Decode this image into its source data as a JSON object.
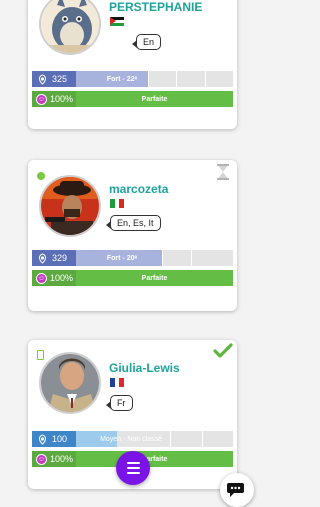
{
  "cards": [
    {
      "username": "PERSTEPHANIE",
      "languages": "En",
      "level_value": "325",
      "level_label": "Fort - 22ᵉ",
      "level_progress": 0.46,
      "reputation_value": "100%",
      "reputation_label": "Parfaite"
    },
    {
      "username": "marcozeta",
      "languages": "En, Es, It",
      "level_value": "329",
      "level_label": "Fort - 20ᵉ",
      "level_progress": 0.55,
      "reputation_value": "100%",
      "reputation_label": "Parfaite"
    },
    {
      "username": "Giulia-Lewis",
      "languages": "Fr",
      "level_value": "100",
      "level_label": "Moyen - Non classé",
      "level_progress": 0.26,
      "reputation_value": "100%",
      "reputation_label": "Parfaite"
    }
  ],
  "colors": {
    "username": "#1da39a",
    "online": "#7ac943",
    "fab": "#7a14e6",
    "reputation": "#64be45"
  },
  "icons": {
    "hourglass": "hourglass-icon",
    "check": "check-icon",
    "menu": "menu-icon",
    "chat": "chat-icon",
    "level": "laurel-icon",
    "reputation": "reputation-icon"
  }
}
